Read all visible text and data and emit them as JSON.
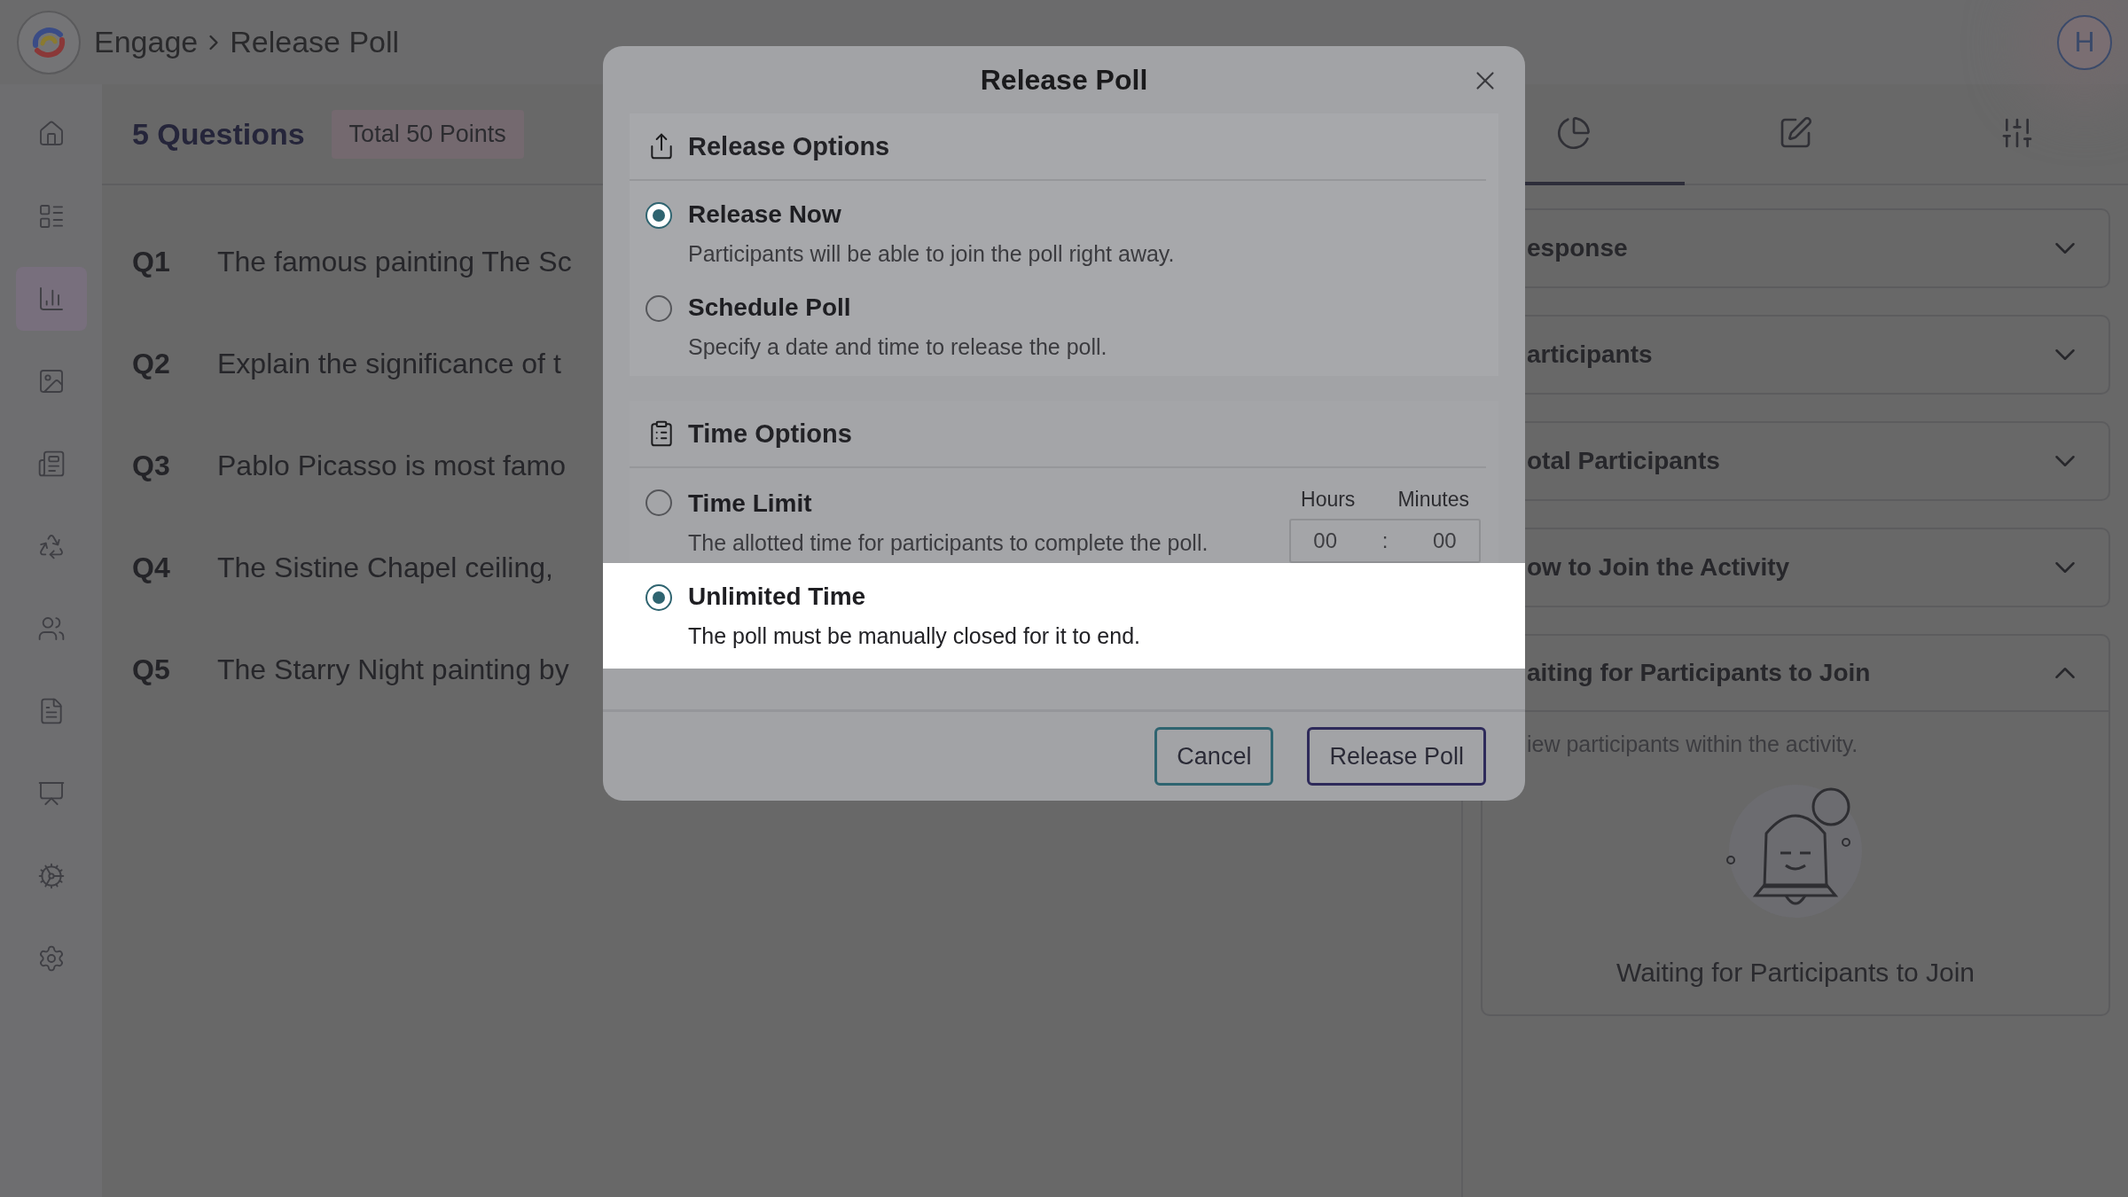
{
  "topbar": {
    "breadcrumb": [
      {
        "label": "Engage"
      },
      {
        "label": "Release Poll"
      }
    ],
    "avatar": "H"
  },
  "sidebar": {
    "items": [
      {
        "selected": false
      },
      {
        "selected": false
      },
      {
        "selected": true
      },
      {
        "selected": false
      },
      {
        "selected": false
      },
      {
        "selected": false
      },
      {
        "selected": false
      },
      {
        "selected": false
      },
      {
        "selected": false
      },
      {
        "selected": false
      },
      {
        "selected": false
      }
    ]
  },
  "summary": {
    "count": "5 Questions",
    "points": "Total 50 Points"
  },
  "questions": [
    {
      "number": "Q1",
      "text": "The famous painting The Sc"
    },
    {
      "number": "Q2",
      "text": "Explain the significance of t"
    },
    {
      "number": "Q3",
      "text": "Pablo Picasso is most famo"
    },
    {
      "number": "Q4",
      "text": "The Sistine Chapel ceiling,"
    },
    {
      "number": "Q5",
      "text": "The Starry Night painting by"
    }
  ],
  "panel": {
    "tabs": [
      {
        "selected": true
      },
      {
        "selected": false
      },
      {
        "selected": false
      }
    ],
    "sections": [
      {
        "title": "esponse",
        "expanded": false
      },
      {
        "title": "articipants",
        "expanded": false
      },
      {
        "title": "otal Participants",
        "expanded": false
      },
      {
        "title": "ow to Join the Activity",
        "expanded": false
      },
      {
        "title": "aiting for Participants to Join",
        "expanded": true,
        "description": "iew participants within the activity.",
        "empty_text": "Waiting for Participants to Join"
      }
    ]
  },
  "dialog": {
    "title": "Release Poll",
    "sections": [
      {
        "title": "Release Options",
        "kind": "release",
        "options": [
          {
            "label": "Release Now",
            "description": "Participants will be able to join the poll right away.",
            "selected": true,
            "highlighted": false
          },
          {
            "label": "Schedule Poll",
            "description": "Specify a date and time to release the poll.",
            "selected": false,
            "highlighted": false
          }
        ]
      },
      {
        "title": "Time Options",
        "kind": "time",
        "options": [
          {
            "label": "Time Limit",
            "description": "The allotted time for participants to complete the poll.",
            "selected": false,
            "highlighted": false,
            "time": {
              "hours_label": "Hours",
              "minutes_label": "Minutes",
              "hours": "00",
              "separator": ":",
              "minutes": "00"
            }
          },
          {
            "label": "Unlimited Time",
            "description": "The poll must be manually closed for it to end.",
            "selected": true,
            "highlighted": true
          }
        ]
      }
    ],
    "buttons": [
      {
        "label": "Cancel",
        "kind": "secondary"
      },
      {
        "label": "Release Poll",
        "kind": "primary"
      }
    ]
  }
}
